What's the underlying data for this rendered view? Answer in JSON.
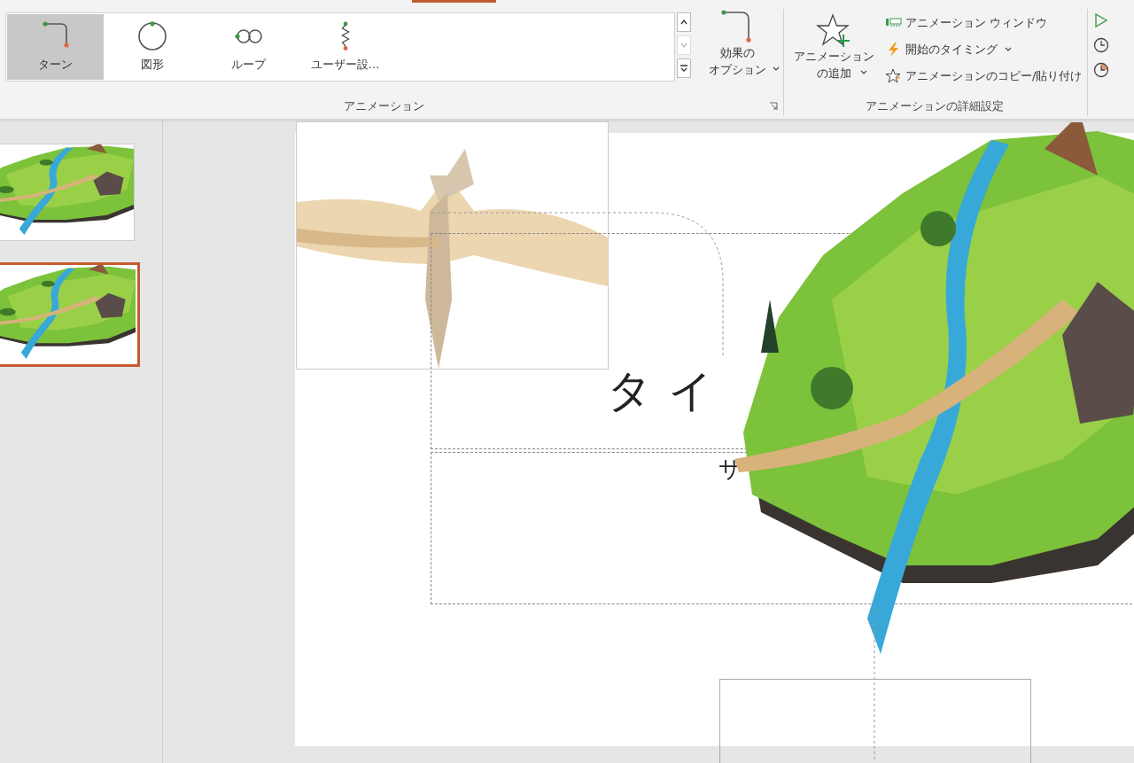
{
  "ribbon": {
    "gallery": {
      "items": [
        {
          "label": "ターン",
          "kind": "turn",
          "selected": true
        },
        {
          "label": "図形",
          "kind": "shape",
          "selected": false
        },
        {
          "label": "ループ",
          "kind": "loop",
          "selected": false
        },
        {
          "label": "ユーザー設…",
          "kind": "custom",
          "selected": false
        }
      ]
    },
    "effect_options": {
      "lines": [
        "効果の",
        "オプション"
      ]
    },
    "groups": [
      {
        "label": "アニメーション"
      },
      {
        "label": "アニメーションの詳細設定"
      }
    ],
    "add_animation": {
      "lines": [
        "アニメーション",
        "の追加"
      ]
    },
    "commands": [
      {
        "label": "アニメーション ウィンドウ",
        "kind": "pane",
        "dropdown": false
      },
      {
        "label": "開始のタイミング",
        "kind": "trigger",
        "dropdown": true
      },
      {
        "label": "アニメーションのコピー/貼り付け",
        "kind": "painter",
        "dropdown": false
      }
    ],
    "timing": [
      {
        "kind": "start"
      },
      {
        "kind": "duration"
      },
      {
        "kind": "delay"
      }
    ]
  },
  "thumbnails": [
    {
      "kind": "picture",
      "selected": false
    },
    {
      "kind": "picture",
      "selected": true
    }
  ],
  "slide": {
    "title": "タイ",
    "subtitle": "サ"
  }
}
